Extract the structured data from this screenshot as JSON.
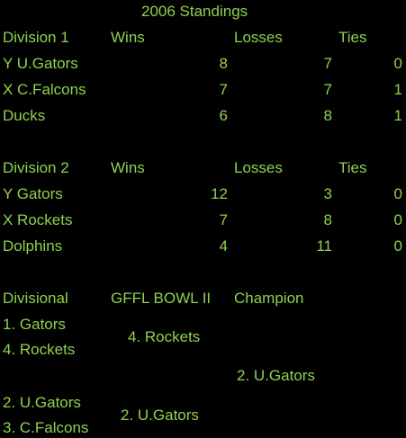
{
  "title": "2006 Standings",
  "headers": {
    "wins": "Wins",
    "losses": "Losses",
    "ties": "Ties"
  },
  "division1": {
    "label": "Division 1",
    "rows": [
      {
        "team": "Y U.Gators",
        "wins": "8",
        "losses": "7",
        "ties": "0"
      },
      {
        "team": "X C.Falcons",
        "wins": "7",
        "losses": "7",
        "ties": "1"
      },
      {
        "team": "Ducks",
        "wins": "6",
        "losses": "8",
        "ties": "1"
      }
    ]
  },
  "division2": {
    "label": "Division 2",
    "rows": [
      {
        "team": "Y Gators",
        "wins": "12",
        "losses": "3",
        "ties": "0"
      },
      {
        "team": "X Rockets",
        "wins": "7",
        "losses": "8",
        "ties": "0"
      },
      {
        "team": "Dolphins",
        "wins": "4",
        "losses": "11",
        "ties": "0"
      }
    ]
  },
  "playoffs": {
    "headers": {
      "divisional": "Divisional",
      "bowl": "GFFL BOWL II",
      "champion": "Champion"
    },
    "divisional": [
      "1. Gators",
      "4. Rockets",
      "2. U.Gators",
      "3. C.Falcons"
    ],
    "bowl": [
      "4. Rockets",
      "2.  U.Gators"
    ],
    "champion": "2. U.Gators"
  },
  "colors": {
    "background": "#000000",
    "text": "#8fd14f"
  }
}
